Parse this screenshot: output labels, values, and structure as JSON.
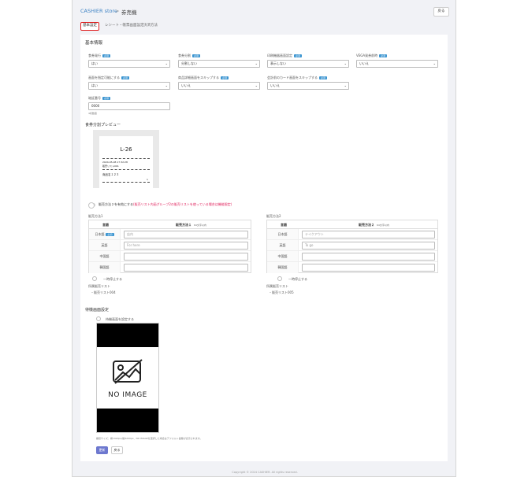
{
  "header": {
    "brand": "CASHIER store",
    "separator": ">",
    "title": "券売機",
    "back_label": "戻る"
  },
  "tabs": [
    {
      "label": "基本設定",
      "active": true
    },
    {
      "label": "レシート・帳票画面設定",
      "active": false
    },
    {
      "label": "決済方法",
      "active": false
    }
  ],
  "basic": {
    "section_title": "基本情報",
    "required_badge": "必須",
    "fields": [
      {
        "label": "食券発行",
        "value": "はい"
      },
      {
        "label": "食券分割",
        "value": "分割しない"
      },
      {
        "label": "印刷機器画面設定",
        "value": "表示しない"
      },
      {
        "label": "VEGA発券前時",
        "value": "いいえ"
      },
      {
        "label": "画面を指定可能にする",
        "value": "はい"
      },
      {
        "label": "商品詳細画面をスキップする",
        "value": "いいえ"
      },
      {
        "label": "会計前のカード画面をスキップする",
        "value": "いいえ"
      }
    ],
    "code_label": "暗証番号",
    "code_value": "0000",
    "code_hint": "4桁数値"
  },
  "preview": {
    "title": "食券分割プレビュー",
    "ticket_number": "L-26",
    "date_line": "2024-05-08 17:32:28",
    "list_line": "販売リスト001",
    "item_line": "商品名１２３",
    "page_no": "1"
  },
  "toggle_note": {
    "text": "販売方法２を有効にする",
    "warning": "(販売リスト内画グループ2の販売リストを使っている場合は機能限定)"
  },
  "method1": {
    "section_label": "販売方法1",
    "col_lang": "言語",
    "col_name": "販売方法１",
    "col_sub": "64文字以内",
    "rows": [
      {
        "lang": "日本語",
        "placeholder": "店内",
        "required": true
      },
      {
        "lang": "英語",
        "placeholder": "For here",
        "required": false
      },
      {
        "lang": "中国語",
        "placeholder": "",
        "required": false
      },
      {
        "lang": "韓国語",
        "placeholder": "",
        "required": false
      }
    ],
    "pause_label": "一時停止する",
    "list_label": "所属販売リスト",
    "list_value": "・販売リスト004"
  },
  "method2": {
    "section_label": "販売方法2",
    "col_lang": "言語",
    "col_name": "販売方法２",
    "col_sub": "64文字以内",
    "rows": [
      {
        "lang": "日本語",
        "placeholder": "テイクアウト",
        "required": false
      },
      {
        "lang": "英語",
        "placeholder": "To go",
        "required": false
      },
      {
        "lang": "中国語",
        "placeholder": "",
        "required": false
      },
      {
        "lang": "韓国語",
        "placeholder": "",
        "required": false
      }
    ],
    "pause_label": "一時停止する",
    "list_label": "所属販売リスト",
    "list_value": "・販売リスト005"
  },
  "standby": {
    "section_title": "待機画面設定",
    "toggle_label": "待機画面を設定する",
    "noimage_text": "NO IMAGE",
    "hint": "推奨サイズ：横1920px/縦3200px、NO IMAGEを選択した場合はデフォルト画像が表示されます。"
  },
  "actions": {
    "update_label": "更新",
    "back_label": "戻る"
  },
  "footer": {
    "copyright": "Copyright © 2024 CASHIER. All rights reserved."
  }
}
